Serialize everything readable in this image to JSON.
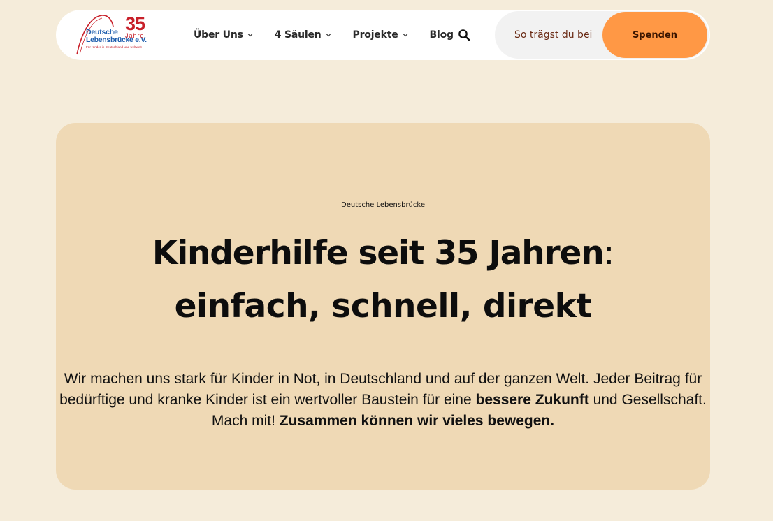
{
  "logo": {
    "line1": "Deutsche",
    "line2": "Lebensbrücke e.V.",
    "years": "35",
    "years_label": "Jahre",
    "tagline": "Für Kinder in Deutschland und weltweit",
    "colors": {
      "blue": "#1f5fae",
      "red": "#c8202a"
    }
  },
  "nav": {
    "items": [
      {
        "label": "Über Uns",
        "has_dropdown": true
      },
      {
        "label": "4 Säulen",
        "has_dropdown": true
      },
      {
        "label": "Projekte",
        "has_dropdown": true
      },
      {
        "label": "Blog",
        "has_dropdown": false
      }
    ],
    "search_icon": "search-icon"
  },
  "cta": {
    "text": "So trägst du bei",
    "donate_label": "Spenden",
    "donate_color": "#ff9845"
  },
  "hero": {
    "eyebrow": "Deutsche Lebensbrücke",
    "title_bold": "Kinderhilfe seit 35 Jahren",
    "title_colon": ":",
    "subtitle": "einfach, schnell, direkt",
    "description": {
      "part1": "Wir machen uns stark für Kinder in Not, in Deutschland und auf der ganzen Welt. Jeder Beitrag für bedürftige und kranke Kinder ist ein wertvoller Baustein für eine ",
      "bold1": "bessere Zukunft",
      "part2": " und Gesellschaft. Mach mit! ",
      "bold2": "Zusammen können wir vieles bewegen."
    },
    "background": "#efd9b5"
  },
  "page_background": "#f5ecda"
}
